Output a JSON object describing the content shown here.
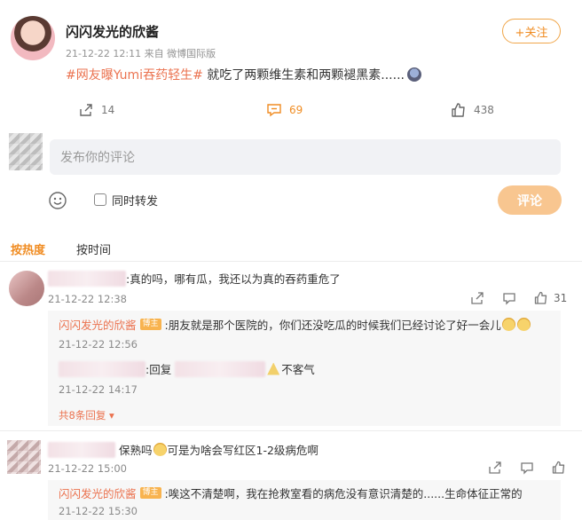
{
  "post": {
    "username": "闪闪发光的欣酱",
    "meta": "21-12-22 12:11  来自 微博国际版",
    "follow_label": "+关注",
    "hashtag": "#网友曝Yumi吞药轻生#",
    "text": " 就吃了两颗维生素和两颗褪黑素......",
    "reposts": "14",
    "comments": "69",
    "likes": "438"
  },
  "composer": {
    "placeholder": "发布你的评论",
    "repost_label": "同时转发",
    "submit_label": "评论"
  },
  "sort_tabs": {
    "hot": "按热度",
    "time": "按时间"
  },
  "comments": [
    {
      "text": ":真的吗，哪有瓜，我还以为真的吞药重危了",
      "time": "21-12-22 12:38",
      "likes": "31",
      "replies": [
        {
          "name": "闪闪发光的欣酱",
          "badge": "博主",
          "text": ":朋友就是那个医院的，你们还没吃瓜的时候我们已经讨论了好一会儿",
          "time": "21-12-22 12:56"
        },
        {
          "text_prefix": ":回复",
          "text_suffix": "不客气",
          "time": "21-12-22 14:17"
        }
      ],
      "more_label": "共8条回复"
    },
    {
      "text_prefix": "保熟吗",
      "text_suffix": "可是为啥会写红区1-2级病危啊",
      "time": "21-12-22 15:00",
      "replies": [
        {
          "name": "闪闪发光的欣酱",
          "badge": "博主",
          "text": ":唉这不清楚啊，我在抢救室看的病危没有意识清楚的......生命体征正常的",
          "time": "21-12-22 15:30"
        }
      ]
    }
  ],
  "colors": {
    "accent": "#f08c22",
    "link": "#eb7350",
    "submit_bg": "#f8c690"
  }
}
